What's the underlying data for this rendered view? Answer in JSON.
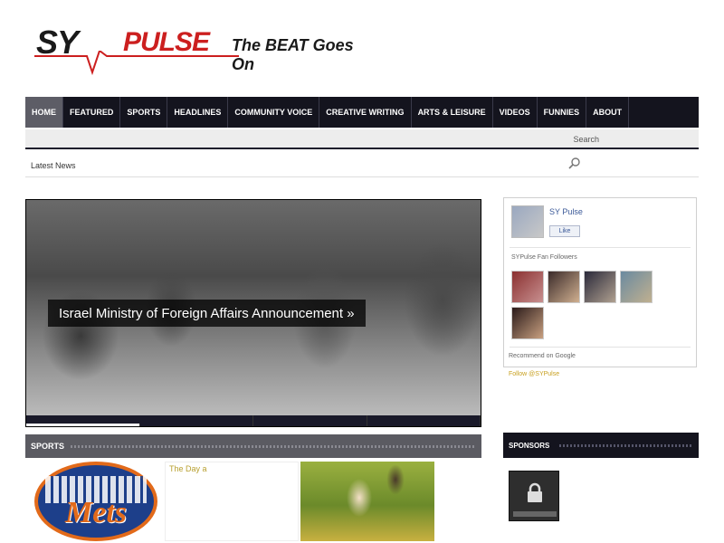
{
  "site": {
    "logo_sy": "SY",
    "logo_pulse": "PULSE",
    "tagline": "The BEAT Goes On",
    "accent": "#cc1f1f",
    "nav_bg": "#14141e"
  },
  "nav": {
    "items": [
      {
        "label": "HOME",
        "active": true
      },
      {
        "label": "FEATURED"
      },
      {
        "label": "SPORTS"
      },
      {
        "label": "HEADLINES"
      },
      {
        "label": "COMMUNITY VOICE"
      },
      {
        "label": "CREATIVE WRITING"
      },
      {
        "label": "ARTS & LEISURE"
      },
      {
        "label": "VIDEOS"
      },
      {
        "label": "FUNNIES"
      },
      {
        "label": "ABOUT"
      }
    ]
  },
  "subbar": {
    "search_label": "Search",
    "latest_news": "Latest News",
    "search_icon": "search-icon"
  },
  "hero": {
    "caption": "Israel Ministry of Foreign Affairs Announcement »",
    "slides_total": 4,
    "slide_current": 1
  },
  "sports": {
    "label": "SPORTS",
    "mets_word": "Mets",
    "tile_text": "The Day a"
  },
  "facebook": {
    "page_name": "SY Pulse",
    "like_label": "Like",
    "likes_caption": "SYPulse Fan Followers"
  },
  "gplus": {
    "label": "Recommend on Google",
    "count": "Follow @SYPulse"
  },
  "sponsors": {
    "label": "SPONSORS",
    "tile_icon": "lock-icon"
  }
}
